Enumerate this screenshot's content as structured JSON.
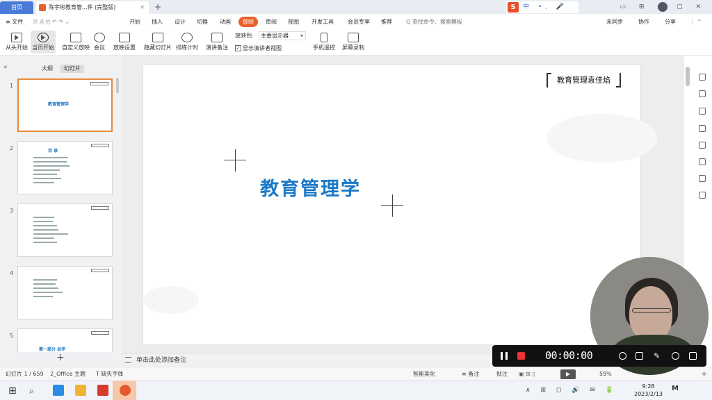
{
  "titlebar": {
    "home_tab": "首页",
    "doc_tab": "陈宇彬教育管...件 (完整版)",
    "add_tab": "+",
    "ime_logo": "S",
    "ime_items": "中 •, 🎤 ▦ ▦"
  },
  "menubar": {
    "file": "≡ 文件",
    "items": [
      "开始",
      "插入",
      "设计",
      "切换",
      "动画",
      "放映",
      "审阅",
      "视图",
      "开发工具",
      "会员专享",
      "推荐"
    ],
    "active_index": 5,
    "search": "Q 查找命令、搜索模板",
    "right_items": [
      "未同步",
      "协作",
      "分享"
    ]
  },
  "ribbon": {
    "buttons": [
      "从头开始",
      "当页开始",
      "自定义放映",
      "会议",
      "放映设置",
      "隐藏幻灯片",
      "排练计时",
      "演讲备注"
    ],
    "monitor_label": "放映到:",
    "monitor_value": "主要显示器",
    "presenter_view": "显示演讲者视图",
    "presenter_checked": "✓",
    "right_buttons": [
      "手机遥控",
      "屏幕录制"
    ]
  },
  "left_panel": {
    "collapse_icon": "«",
    "tabs": [
      "大纲",
      "幻灯片"
    ],
    "active_tab": 1,
    "thumb_titles": [
      "教育管理学",
      "目 录",
      "",
      "",
      "第一部分 总学"
    ],
    "thumb_numbers": [
      "1",
      "2",
      "3",
      "4",
      "5"
    ],
    "add": "+"
  },
  "slide": {
    "author": "教育管理袁佳焰",
    "title": "教育管理学"
  },
  "notes_placeholder": "单击此处添加备注",
  "status": {
    "slide_counter": "幻灯片 1 / 659",
    "theme": "2_Office 主题",
    "font_missing": "T 缺失字体",
    "smart": "智能美化",
    "notes": "≡ 备注",
    "comments": "批注",
    "zoom": "59%"
  },
  "recorder": {
    "time": "00:00:00"
  },
  "taskbar": {
    "time": "9:28",
    "date": "2023/2/13",
    "tray": "∧ ⊞ ◻ 🔊 ✉ 🔋"
  },
  "colors": {
    "accent": "#e8612c",
    "title_blue": "#1b78c7",
    "home_tab": "#4a7bd9"
  }
}
